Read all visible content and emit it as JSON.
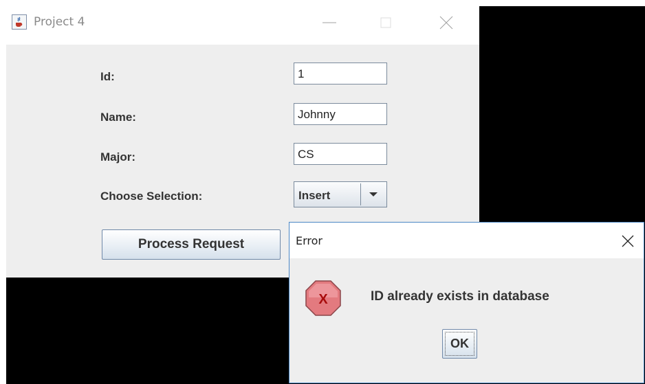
{
  "main_window": {
    "title": "Project 4",
    "icon": "java-cup-icon",
    "fields": {
      "id_label": "Id:",
      "id_value": "1",
      "name_label": "Name:",
      "name_value": "Johnny",
      "major_label": "Major:",
      "major_value": "CS",
      "selection_label": "Choose Selection:",
      "selection_value": "Insert"
    },
    "process_button": "Process Request"
  },
  "error_dialog": {
    "title": "Error",
    "icon": "error-x-icon",
    "message": "ID already exists in database",
    "ok_button": "OK"
  },
  "colors": {
    "dialog_border": "#4a86c5",
    "error_icon_fill": "#e37a7f",
    "error_x": "#b01010"
  }
}
